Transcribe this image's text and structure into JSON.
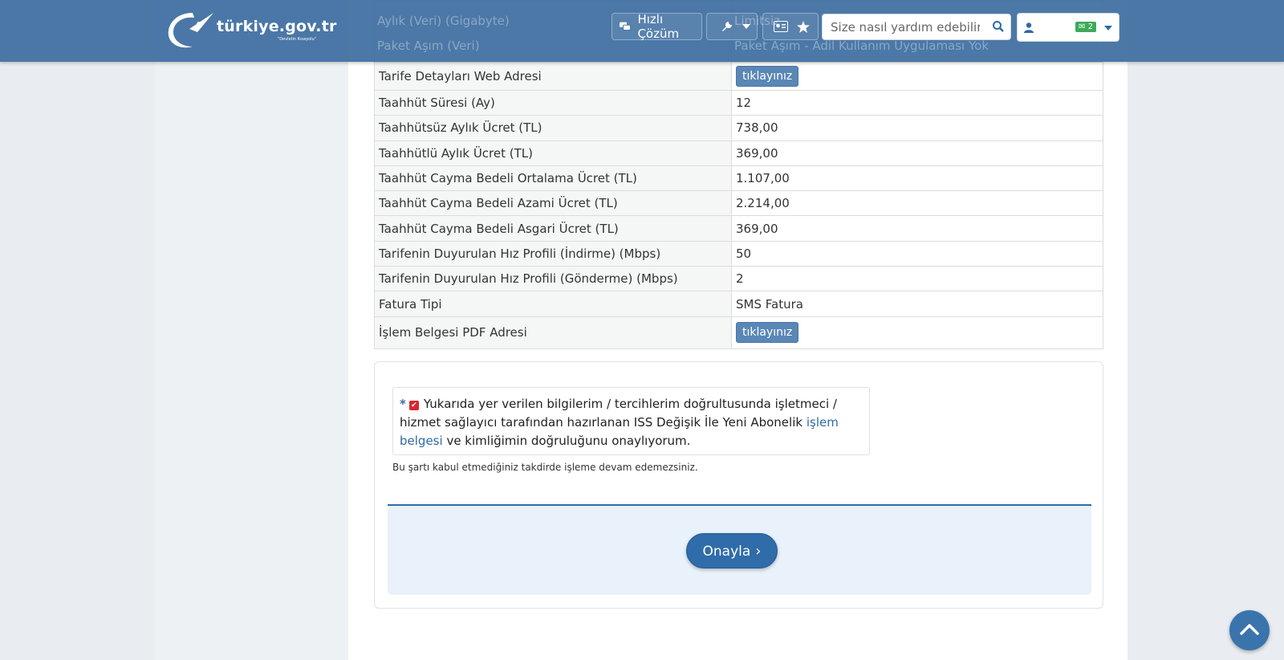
{
  "header": {
    "logo_text": "türkiye.gov.tr",
    "logo_sub": "\"Devletin Kısayolu\"",
    "quick_solution": "Hızlı Çözüm",
    "search_placeholder": "Size nasıl yardım edebilirim?",
    "mail_count": "2"
  },
  "ghost_rows": [
    {
      "label": "Aylık (Veri) (Gigabyte)",
      "value": "Limitsiz"
    },
    {
      "label": "Paket Aşım (Veri)",
      "value": "Paket Aşım - Adil Kullanım Uygulaması Yok"
    }
  ],
  "table": {
    "rows": [
      {
        "label": "Tarife Detayları Web Adresi",
        "value": "tıklayınız"
      },
      {
        "label": "Taahhüt Süresi (Ay)",
        "value": "12"
      },
      {
        "label": "Taahhütsüz Aylık Ücret (TL)",
        "value": "738,00"
      },
      {
        "label": "Taahhütlü Aylık Ücret (TL)",
        "value": "369,00"
      },
      {
        "label": "Taahhüt Cayma Bedeli Ortalama Ücret (TL)",
        "value": "1.107,00"
      },
      {
        "label": "Taahhüt Cayma Bedeli Azami Ücret (TL)",
        "value": "2.214,00"
      },
      {
        "label": "Taahhüt Cayma Bedeli Asgari Ücret (TL)",
        "value": "369,00"
      },
      {
        "label": "Tarifenin Duyurulan Hız Profili (İndirme) (Mbps)",
        "value": "50"
      },
      {
        "label": "Tarifenin Duyurulan Hız Profili (Gönderme) (Mbps)",
        "value": "2"
      },
      {
        "label": "Fatura Tipi",
        "value": "SMS Fatura"
      },
      {
        "label": "İşlem Belgesi PDF Adresi",
        "value": "tıklayınız"
      }
    ]
  },
  "confirm": {
    "required_mark": "*",
    "text_before": "Yukarıda yer verilen bilgilerim / tercihlerim doğrultusunda işletmeci / hizmet sağlayıcı tarafından hazırlanan ISS Değişik İle Yeni Abonelik",
    "link_text": "işlem belgesi",
    "text_after": "ve kimliğimin doğruluğunu onaylıyorum.",
    "note": "Bu şartı kabul etmediğiniz takdirde işleme devam edemezsiniz.",
    "submit_label": "Onayla"
  }
}
